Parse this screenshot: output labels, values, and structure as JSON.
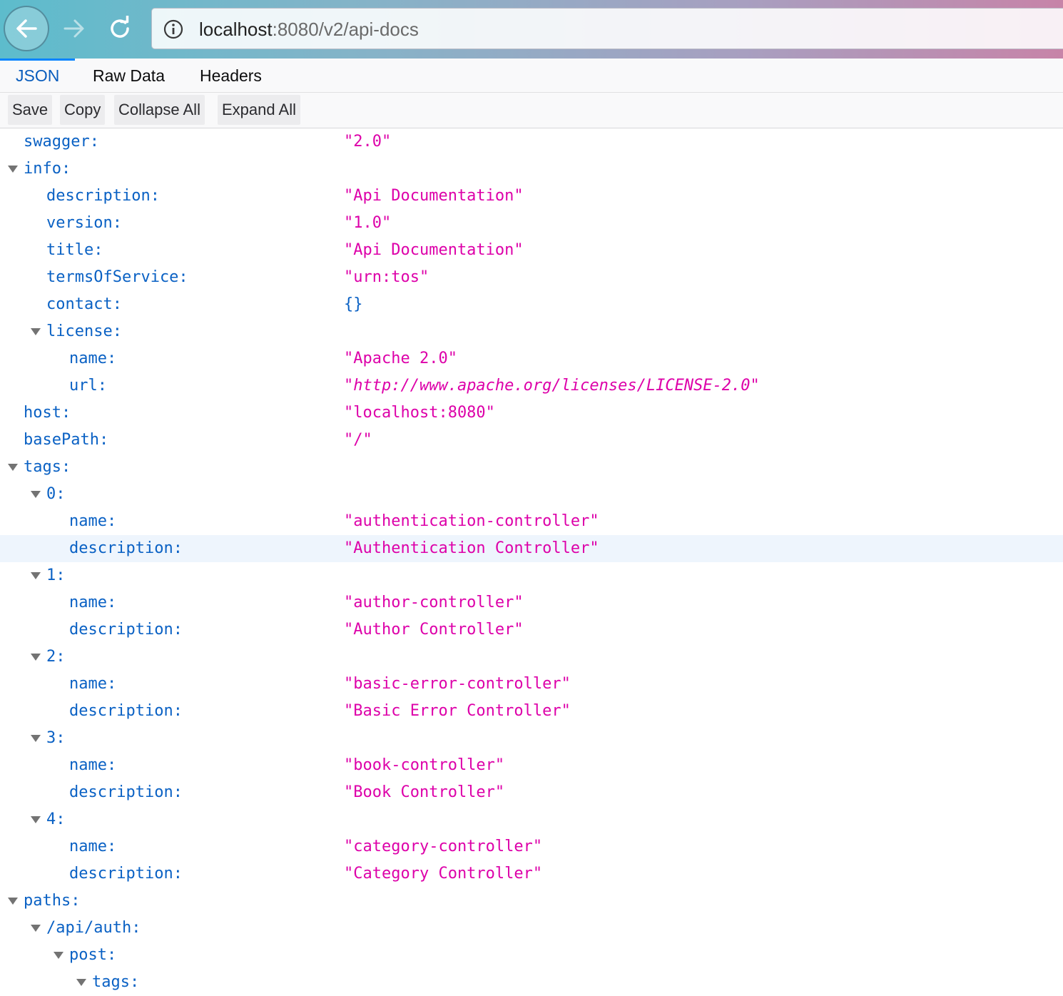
{
  "browser": {
    "url_host": "localhost",
    "url_rest": ":8080/v2/api-docs"
  },
  "tabs": [
    "JSON",
    "Raw Data",
    "Headers"
  ],
  "actions": [
    "Save",
    "Copy",
    "Collapse All",
    "Expand All"
  ],
  "rows": [
    {
      "key": "swagger:",
      "value": "\"2.0\""
    },
    {
      "key": "info:"
    },
    {
      "key": "description:",
      "value": "\"Api Documentation\""
    },
    {
      "key": "version:",
      "value": "\"1.0\""
    },
    {
      "key": "title:",
      "value": "\"Api Documentation\""
    },
    {
      "key": "termsOfService:",
      "value": "\"urn:tos\""
    },
    {
      "key": "contact:",
      "value": "{}"
    },
    {
      "key": "license:"
    },
    {
      "key": "name:",
      "value": "\"Apache 2.0\""
    },
    {
      "key": "url:",
      "value_prefix": "\"",
      "value_link": "http://www.apache.org/licenses/LICENSE-2.0",
      "value_suffix": "\""
    },
    {
      "key": "host:",
      "value": "\"localhost:8080\""
    },
    {
      "key": "basePath:",
      "value": "\"/\""
    },
    {
      "key": "tags:"
    },
    {
      "key": "0:"
    },
    {
      "key": "name:",
      "value": "\"authentication-controller\""
    },
    {
      "key": "description:",
      "value": "\"Authentication Controller\""
    },
    {
      "key": "1:"
    },
    {
      "key": "name:",
      "value": "\"author-controller\""
    },
    {
      "key": "description:",
      "value": "\"Author Controller\""
    },
    {
      "key": "2:"
    },
    {
      "key": "name:",
      "value": "\"basic-error-controller\""
    },
    {
      "key": "description:",
      "value": "\"Basic Error Controller\""
    },
    {
      "key": "3:"
    },
    {
      "key": "name:",
      "value": "\"book-controller\""
    },
    {
      "key": "description:",
      "value": "\"Book Controller\""
    },
    {
      "key": "4:"
    },
    {
      "key": "name:",
      "value": "\"category-controller\""
    },
    {
      "key": "description:",
      "value": "\"Category Controller\""
    },
    {
      "key": "paths:"
    },
    {
      "key": "/api/auth:"
    },
    {
      "key": "post:"
    },
    {
      "key": "tags:"
    }
  ]
}
